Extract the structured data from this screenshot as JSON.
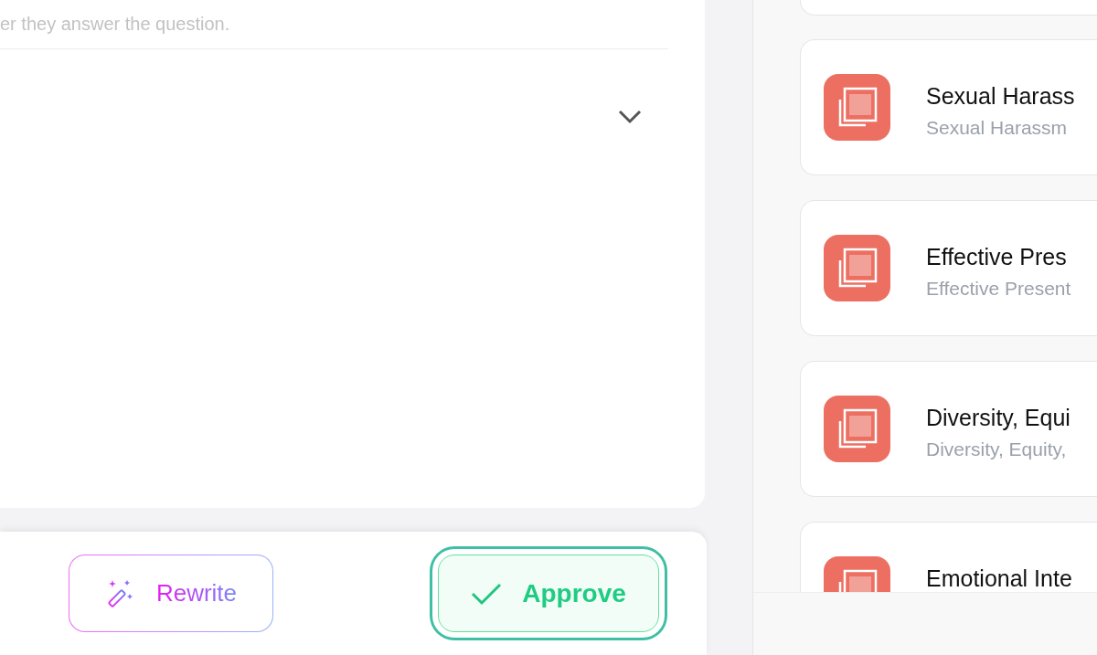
{
  "question": {
    "hint": "er they answer the question."
  },
  "actions": [
    {
      "kind": "rewrite",
      "label": "Rewrite",
      "focused": false
    },
    {
      "kind": "approve",
      "label": "Approve",
      "focused": true
    }
  ],
  "documents": [
    {
      "title": "Sexual Harass",
      "subtitle": "Sexual Harassm"
    },
    {
      "title": "Effective Pres",
      "subtitle": "Effective Present"
    },
    {
      "title": "Diversity, Equi",
      "subtitle": "Diversity, Equity,"
    },
    {
      "title": "Emotional Inte"
    }
  ]
}
